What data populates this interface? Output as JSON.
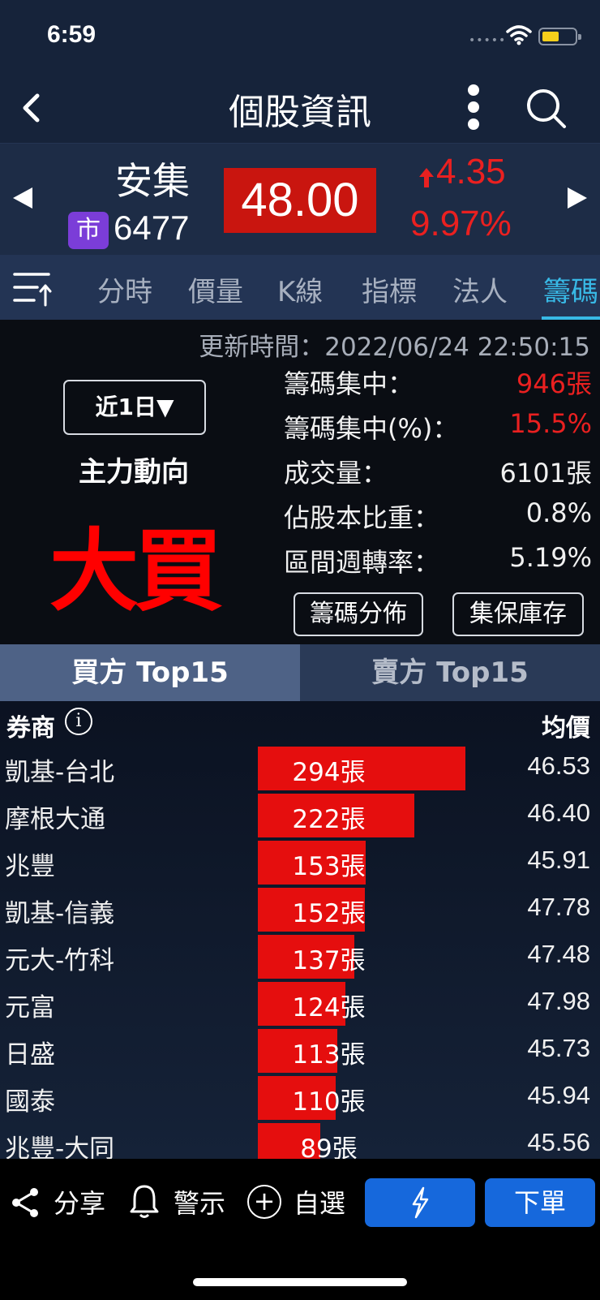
{
  "status_bar": {
    "time": "6:59",
    "signal": "•••••"
  },
  "nav": {
    "title": "個股資訊"
  },
  "quote": {
    "name": "安集",
    "market_badge": "市",
    "code": "6477",
    "price": "48.00",
    "change": "4.35",
    "change_pct": "9.97%",
    "up_color": "#ea2020"
  },
  "tabs": [
    "分時",
    "價量",
    "K線",
    "指標",
    "法人",
    "籌碼"
  ],
  "active_tab": "籌碼",
  "info": {
    "update_time": "更新時間：2022/06/24 22:50:15",
    "period": "近1日▼",
    "trend_label": "主力動向",
    "trend_value": "大買",
    "stats": [
      {
        "label": "籌碼集中：",
        "value": "946張",
        "highlight": true
      },
      {
        "label": "籌碼集中(%)：",
        "value": "15.5%",
        "highlight": true
      },
      {
        "label": "成交量：",
        "value": "6101張",
        "highlight": false
      },
      {
        "label": "佔股本比重：",
        "value": "0.8%",
        "highlight": false
      },
      {
        "label": "區間週轉率：",
        "value": "5.19%",
        "highlight": false
      }
    ],
    "btn_distribution": "籌碼分佈",
    "btn_custody": "集保庫存"
  },
  "segments": {
    "buy": "買方 Top15",
    "sell": "賣方 Top15"
  },
  "brokers": {
    "col_broker": "券商",
    "col_avg": "均價",
    "rows": [
      {
        "name": "凱基-台北",
        "volume": 294,
        "volume_label": "294張",
        "avg": "46.53"
      },
      {
        "name": "摩根大通",
        "volume": 222,
        "volume_label": "222張",
        "avg": "46.40"
      },
      {
        "name": "兆豐",
        "volume": 153,
        "volume_label": "153張",
        "avg": "45.91"
      },
      {
        "name": "凱基-信義",
        "volume": 152,
        "volume_label": "152張",
        "avg": "47.78"
      },
      {
        "name": "元大-竹科",
        "volume": 137,
        "volume_label": "137張",
        "avg": "47.48"
      },
      {
        "name": "元富",
        "volume": 124,
        "volume_label": "124張",
        "avg": "47.98"
      },
      {
        "name": "日盛",
        "volume": 113,
        "volume_label": "113張",
        "avg": "45.73"
      },
      {
        "name": "國泰",
        "volume": 110,
        "volume_label": "110張",
        "avg": "45.94"
      },
      {
        "name": "兆豐-大同",
        "volume": 89,
        "volume_label": "89張",
        "avg": "45.56"
      }
    ]
  },
  "bottom": {
    "share": "分享",
    "alert": "警示",
    "watchlist": "自選",
    "order": "下單"
  }
}
